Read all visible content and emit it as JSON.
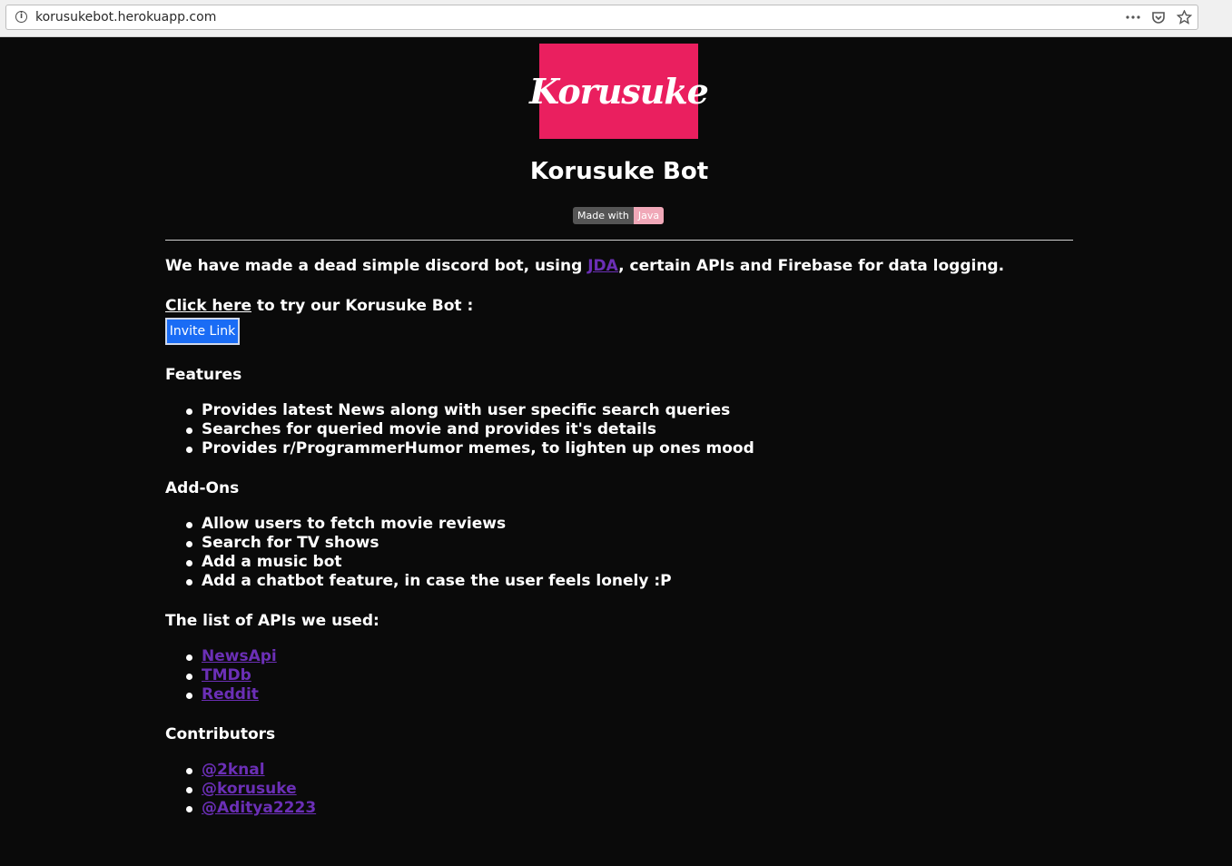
{
  "browser": {
    "url": "korusukebot.herokuapp.com",
    "info_icon": "info-icon",
    "actions": [
      "more-icon",
      "pocket-icon",
      "bookmark-star-icon"
    ]
  },
  "header": {
    "logo_text": "Korusuke",
    "title": "Korusuke Bot",
    "badge_left": "Made with",
    "badge_right": "Java"
  },
  "intro": {
    "before": "We have made a dead simple discord bot, using ",
    "jda_link": "JDA",
    "after": ", certain APIs and Firebase for data logging."
  },
  "invite": {
    "click_here": "Click here",
    "rest": " to try our Korusuke Bot :",
    "button": "Invite Link"
  },
  "features": {
    "heading": "Features",
    "items": [
      "Provides latest News along with user specific search queries",
      "Searches for queried movie and provides it's details",
      "Provides r/ProgrammerHumor memes, to lighten up ones mood"
    ]
  },
  "addons": {
    "heading": "Add-Ons",
    "items": [
      "Allow users to fetch movie reviews",
      "Search for TV shows",
      "Add a music bot",
      "Add a chatbot feature, in case the user feels lonely :P"
    ]
  },
  "apis": {
    "heading": "The list of APIs we used:",
    "items": [
      "NewsApi",
      "TMDb",
      "Reddit"
    ]
  },
  "contributors": {
    "heading": "Contributors",
    "items": [
      "@2knal",
      "@korusuke",
      "@Aditya2223"
    ]
  },
  "colors": {
    "background": "#0a0a0a",
    "logo_bg": "#ea1f5f",
    "link": "#6b2fb6",
    "button": "#1a6cf5"
  }
}
